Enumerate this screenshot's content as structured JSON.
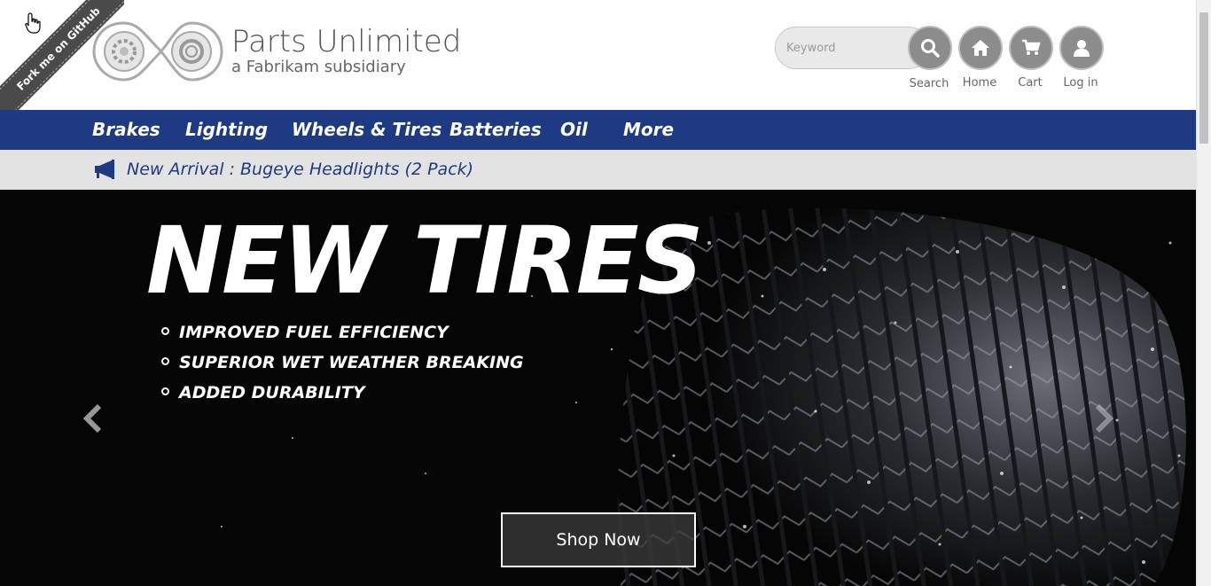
{
  "ribbon": {
    "label": "Fork me on GitHub"
  },
  "brand": {
    "title": "Parts Unlimited",
    "subtitle": "a Fabrikam subsidiary"
  },
  "search": {
    "placeholder": "Keyword",
    "label": "Search"
  },
  "header_buttons": [
    {
      "label": "Home",
      "icon": "home-icon"
    },
    {
      "label": "Cart",
      "icon": "cart-icon"
    },
    {
      "label": "Log in",
      "icon": "user-icon"
    }
  ],
  "nav": {
    "items": [
      "Brakes",
      "Lighting",
      "Wheels & Tires",
      "Batteries",
      "Oil",
      "More"
    ]
  },
  "announcement": {
    "icon": "megaphone-icon",
    "text": "New Arrival : Bugeye Headlights (2 Pack)"
  },
  "hero": {
    "title": "NEW TIRES",
    "features": [
      "IMPROVED FUEL EFFICIENCY",
      "SUPERIOR WET WEATHER BREAKING",
      "ADDED DURABILITY"
    ],
    "cta": "Shop Now"
  },
  "colors": {
    "nav_bg": "#1e3a82",
    "announce_bg": "#e3e3e3",
    "hero_bg": "#050505",
    "icon_circle": "#8c8c8c"
  }
}
